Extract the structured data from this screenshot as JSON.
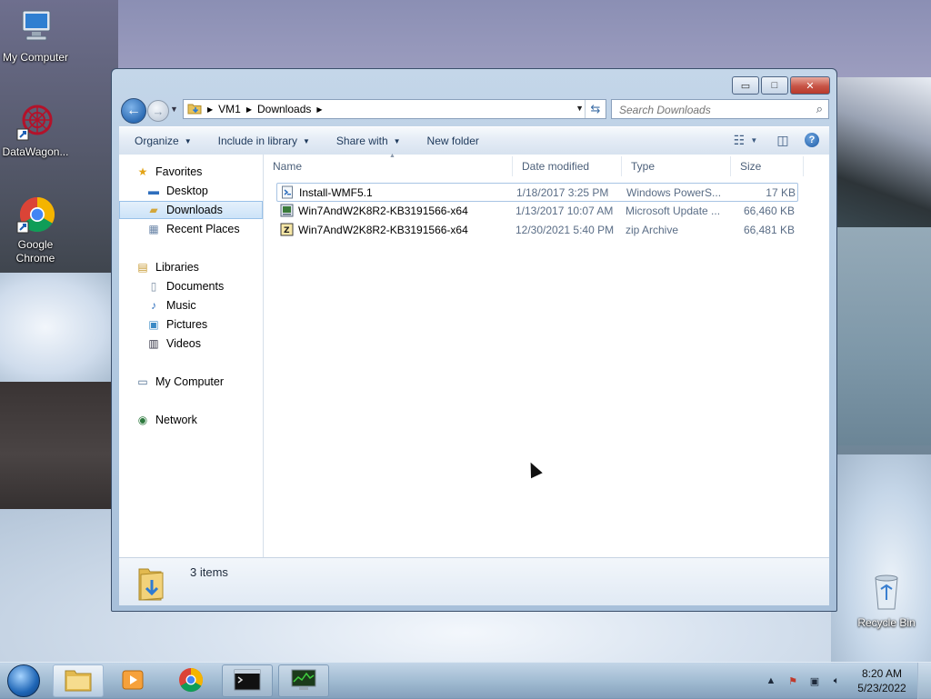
{
  "desktop": {
    "icons": [
      {
        "label": "My Computer"
      },
      {
        "label": "DataWagon..."
      },
      {
        "label": "Google Chrome"
      },
      {
        "label": "Recycle Bin"
      }
    ]
  },
  "window": {
    "caption_buttons": {
      "minimize": "▭",
      "maximize": "□",
      "close": "✕"
    },
    "breadcrumb": [
      "VM1",
      "Downloads"
    ],
    "search_placeholder": "Search Downloads",
    "toolbar": {
      "organize": "Organize",
      "include_in_library": "Include in library",
      "share_with": "Share with",
      "new_folder": "New folder"
    },
    "nav": {
      "favorites": "Favorites",
      "desktop": "Desktop",
      "downloads": "Downloads",
      "recent_places": "Recent Places",
      "libraries": "Libraries",
      "documents": "Documents",
      "music": "Music",
      "pictures": "Pictures",
      "videos": "Videos",
      "my_computer": "My Computer",
      "network": "Network"
    },
    "columns": {
      "name": "Name",
      "date_modified": "Date modified",
      "type": "Type",
      "size": "Size"
    },
    "files": [
      {
        "name": "Install-WMF5.1",
        "date": "1/18/2017 3:25 PM",
        "type": "Windows PowerS...",
        "size": "17 KB",
        "icon": "powershell-script-icon"
      },
      {
        "name": "Win7AndW2K8R2-KB3191566-x64",
        "date": "1/13/2017 10:07 AM",
        "type": "Microsoft Update ...",
        "size": "66,460 KB",
        "icon": "msu-package-icon"
      },
      {
        "name": "Win7AndW2K8R2-KB3191566-x64",
        "date": "12/30/2021 5:40 PM",
        "type": "zip Archive",
        "size": "66,481 KB",
        "icon": "zip-archive-icon"
      }
    ],
    "details": {
      "count": "3 items"
    }
  },
  "taskbar": {
    "clock_time": "8:20 AM",
    "clock_date": "5/23/2022"
  }
}
